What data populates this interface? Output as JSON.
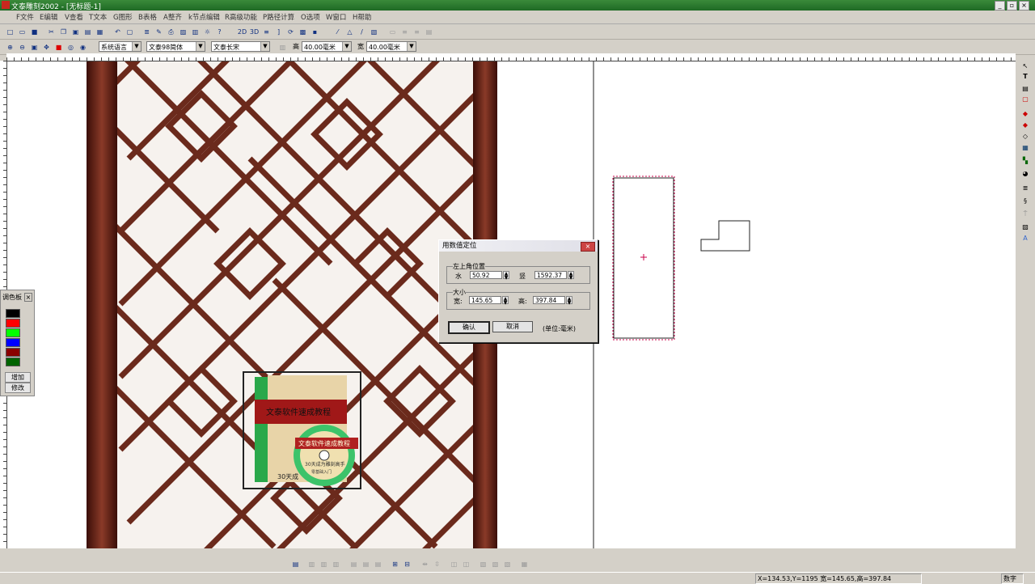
{
  "window": {
    "title": "文泰雕刻2002 - [无标题-1]",
    "min_label": "_",
    "restore_label": "▫",
    "close_label": "×"
  },
  "menu": [
    "F文件",
    "E编辑",
    "V查看",
    "T文本",
    "G图形",
    "B表格",
    "A整齐",
    "k节点编辑",
    "R高级功能",
    "P路径计算",
    "O选项",
    "W窗口",
    "H帮助"
  ],
  "toolbar2": {
    "language": "系统语言",
    "font1": "文泰98简体",
    "font2": "文泰长宋",
    "height_label": "高",
    "height_value": "40.00毫米",
    "width_label": "宽",
    "width_value": "40.00毫米"
  },
  "toolbar_glyphs": {
    "b2d": "2D",
    "b3d": "3D"
  },
  "palette": {
    "title": "调色板",
    "close": "×",
    "colors": [
      "#000000",
      "#ff0000",
      "#00ff00",
      "#0000ff",
      "#8b0000",
      "#006400"
    ],
    "add_label": "增加",
    "edit_label": "修改"
  },
  "dialog": {
    "title": "用数值定位",
    "close": "×",
    "pos_group": "左上角位置",
    "h_label": "水",
    "h_value": "50.92",
    "v_label": "竖",
    "v_value": "1592.37",
    "size_group": "大小",
    "w_label": "宽:",
    "w_value": "145.65",
    "ht_label": "高:",
    "ht_value": "397.84",
    "ok": "确认",
    "cancel": "取消",
    "unit": "(单位:毫米)"
  },
  "product": {
    "title": "文泰软件速成教程",
    "disc_title": "文泰软件速成教程",
    "side_text": "30天成",
    "disc_text1": "30天成为雕刻高手",
    "disc_text2": "零基础入门"
  },
  "status": {
    "coords": "X=134.53,Y=1195 宽=145.65,高=397.84",
    "mode": "数字"
  },
  "colors": {
    "selection": "#c8004a",
    "frame_wood": "#5a1a10"
  }
}
